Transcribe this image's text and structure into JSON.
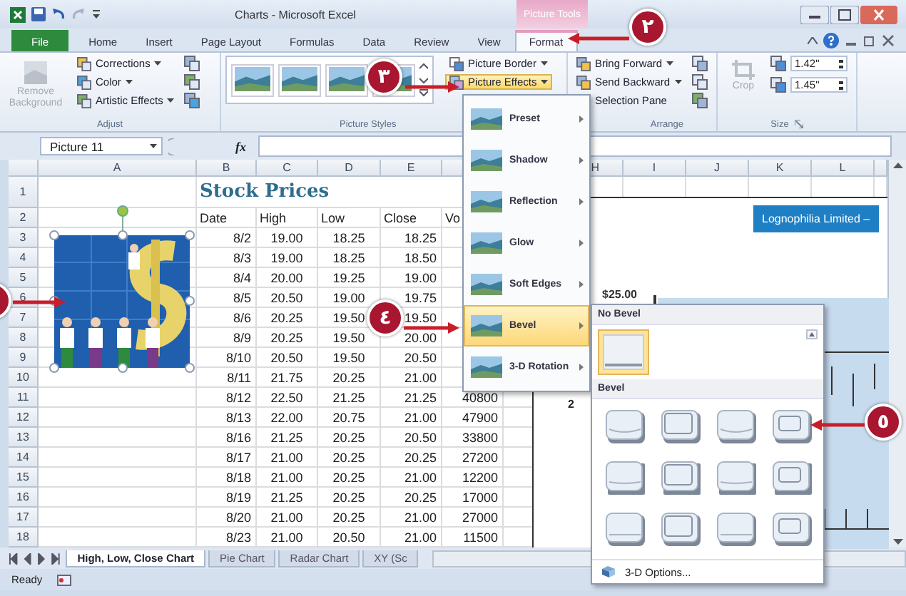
{
  "window": {
    "title": "Charts - Microsoft Excel",
    "context_tab": "Picture Tools"
  },
  "tabs": [
    {
      "label": "File",
      "kind": "file",
      "selected": false
    },
    {
      "label": "Home",
      "kind": "tab",
      "selected": false
    },
    {
      "label": "Insert",
      "kind": "tab",
      "selected": false
    },
    {
      "label": "Page Layout",
      "kind": "tab",
      "selected": false
    },
    {
      "label": "Formulas",
      "kind": "tab",
      "selected": false
    },
    {
      "label": "Data",
      "kind": "tab",
      "selected": false
    },
    {
      "label": "Review",
      "kind": "tab",
      "selected": false
    },
    {
      "label": "View",
      "kind": "tab",
      "selected": false
    },
    {
      "label": "Format",
      "kind": "tab",
      "selected": true
    }
  ],
  "ribbon": {
    "adjust": {
      "label": "Adjust",
      "remove_background": {
        "label": "Remove Background",
        "disabled": true
      },
      "commands": [
        {
          "label": "Corrections",
          "dropdown": true
        },
        {
          "label": "Color",
          "dropdown": true
        },
        {
          "label": "Artistic Effects",
          "dropdown": true
        }
      ]
    },
    "picture_styles": {
      "label": "Picture Styles",
      "commands": [
        {
          "label": "Picture Border",
          "dropdown": true,
          "active": false
        },
        {
          "label": "Picture Effects",
          "dropdown": true,
          "active": true
        }
      ]
    },
    "arrange": {
      "label": "Arrange",
      "commands": [
        {
          "label": "Bring Forward",
          "dropdown": true
        },
        {
          "label": "Send Backward",
          "dropdown": true
        },
        {
          "label": "Selection Pane",
          "dropdown": false
        }
      ]
    },
    "size": {
      "label": "Size",
      "crop": {
        "label": "Crop",
        "disabled": true
      },
      "height": "1.42\"",
      "width": "1.45\""
    }
  },
  "formula_bar": {
    "name_box": "Picture 11",
    "function_label": "fx"
  },
  "sheet": {
    "column_headers_left": [
      "A",
      "B",
      "C",
      "D",
      "E"
    ],
    "column_headers_right": [
      "H",
      "I",
      "J",
      "K",
      "L"
    ],
    "rows": [
      {
        "number": "1",
        "kind": "title",
        "cells": [
          "Stock Prices"
        ]
      },
      {
        "number": "2",
        "kind": "header",
        "cells": [
          "Date",
          "High",
          "Low",
          "Close",
          "Vo"
        ]
      },
      {
        "number": "3",
        "kind": "data",
        "cells": [
          "8/2",
          "19.00",
          "18.25",
          "18.25"
        ]
      },
      {
        "number": "4",
        "kind": "data",
        "cells": [
          "8/3",
          "19.00",
          "18.25",
          "18.50"
        ]
      },
      {
        "number": "5",
        "kind": "data",
        "cells": [
          "8/4",
          "20.00",
          "19.25",
          "19.00"
        ]
      },
      {
        "number": "6",
        "kind": "data",
        "cells": [
          "8/5",
          "20.50",
          "19.00",
          "19.75"
        ]
      },
      {
        "number": "7",
        "kind": "data",
        "cells": [
          "8/6",
          "20.25",
          "19.50",
          "19.50"
        ]
      },
      {
        "number": "8",
        "kind": "data",
        "cells": [
          "8/9",
          "20.25",
          "19.50",
          "20.00"
        ]
      },
      {
        "number": "9",
        "kind": "data",
        "cells": [
          "8/10",
          "20.50",
          "19.50",
          "20.50"
        ]
      },
      {
        "number": "10",
        "kind": "data",
        "cells": [
          "8/11",
          "21.75",
          "20.25",
          "21.00"
        ]
      },
      {
        "number": "11",
        "kind": "data",
        "cells": [
          "8/12",
          "22.50",
          "21.25",
          "21.25",
          "40800"
        ]
      },
      {
        "number": "12",
        "kind": "data",
        "cells": [
          "8/13",
          "22.00",
          "20.75",
          "21.00",
          "47900"
        ]
      },
      {
        "number": "13",
        "kind": "data",
        "cells": [
          "8/16",
          "21.25",
          "20.25",
          "20.50",
          "33800"
        ]
      },
      {
        "number": "14",
        "kind": "data",
        "cells": [
          "8/17",
          "21.00",
          "20.25",
          "20.25",
          "27200"
        ]
      },
      {
        "number": "15",
        "kind": "data",
        "cells": [
          "8/18",
          "21.00",
          "20.25",
          "21.00",
          "12200"
        ]
      },
      {
        "number": "16",
        "kind": "data",
        "cells": [
          "8/19",
          "21.25",
          "20.25",
          "20.25",
          "17000"
        ]
      },
      {
        "number": "17",
        "kind": "data",
        "cells": [
          "8/20",
          "21.00",
          "20.25",
          "21.00",
          "27000"
        ]
      },
      {
        "number": "18",
        "kind": "data",
        "cells": [
          "8/23",
          "21.00",
          "20.50",
          "21.00",
          "11500"
        ]
      }
    ]
  },
  "chart": {
    "title": "Lognophilia Limited –",
    "axis_label": "$25.00",
    "mark": "2"
  },
  "sheet_tabs": [
    {
      "label": "High, Low, Close Chart",
      "selected": true
    },
    {
      "label": "Pie Chart",
      "selected": false
    },
    {
      "label": "Radar Chart",
      "selected": false
    },
    {
      "label": "XY (Sc",
      "selected": false
    }
  ],
  "status_bar": {
    "text": "Ready"
  },
  "effects_menu": {
    "items": [
      {
        "label": "Preset",
        "selected": false
      },
      {
        "label": "Shadow",
        "selected": false
      },
      {
        "label": "Reflection",
        "selected": false
      },
      {
        "label": "Glow",
        "selected": false
      },
      {
        "label": "Soft Edges",
        "selected": false
      },
      {
        "label": "Bevel",
        "selected": true
      },
      {
        "label": "3-D Rotation",
        "selected": false
      }
    ]
  },
  "bevel_gallery": {
    "none_header": "No Bevel",
    "none_option": {
      "selected": true
    },
    "header": "Bevel",
    "options": [
      {
        "selected": false
      },
      {
        "selected": false
      },
      {
        "selected": false
      },
      {
        "selected": false
      },
      {
        "selected": false
      },
      {
        "selected": false
      },
      {
        "selected": false
      },
      {
        "selected": false
      },
      {
        "selected": false
      },
      {
        "selected": false
      },
      {
        "selected": false
      },
      {
        "selected": false
      }
    ],
    "more": "3-D Options..."
  },
  "steps": [
    {
      "label": "٢"
    },
    {
      "label": "٣"
    },
    {
      "label": "٤"
    },
    {
      "label": "٥"
    }
  ]
}
